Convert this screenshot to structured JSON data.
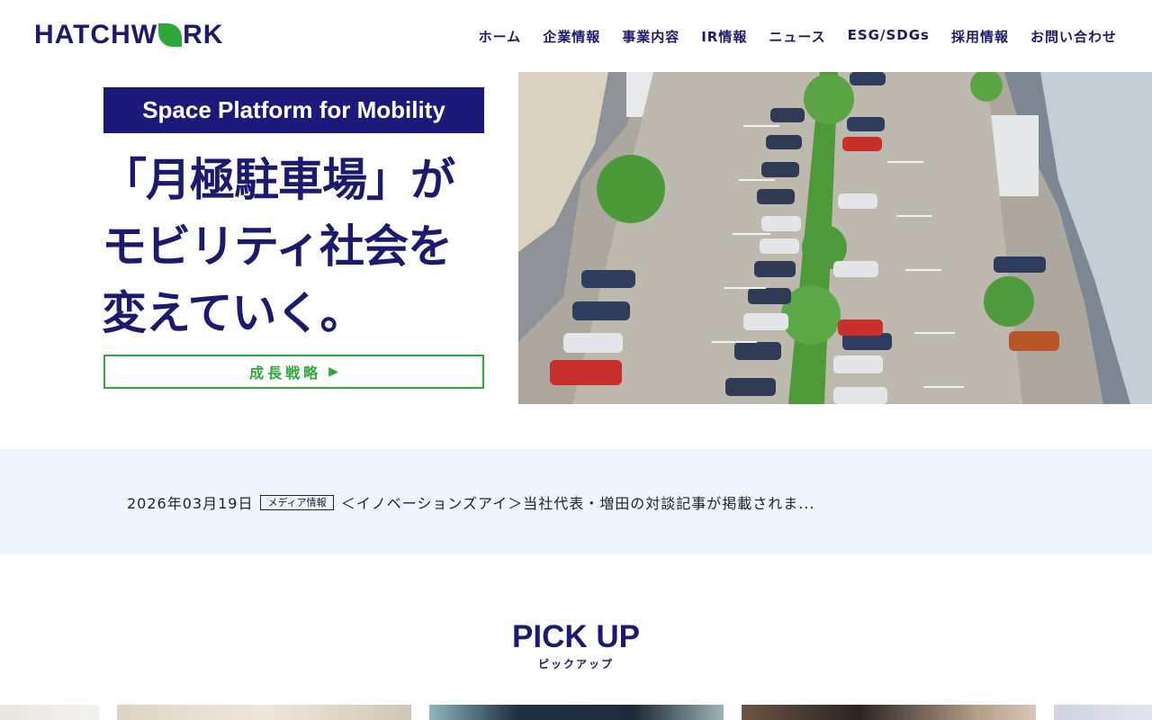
{
  "header": {
    "logo_text_left": "HATCHW",
    "logo_text_right": "RK",
    "nav": [
      {
        "label": "ホーム"
      },
      {
        "label": "企業情報"
      },
      {
        "label": "事業内容"
      },
      {
        "label": "IR情報"
      },
      {
        "label": "ニュース"
      },
      {
        "label": "ESG/SDGs"
      },
      {
        "label": "採用情報"
      },
      {
        "label": "お問い合わせ"
      }
    ]
  },
  "hero": {
    "tagline": "Space Platform for Mobility",
    "headline_lines": [
      "「月極駐車場」が",
      "モビリティ社会を",
      "変えていく。"
    ],
    "button_label": "成長戦略",
    "button_arrow": "▶"
  },
  "news": {
    "date": "2026年03月19日",
    "category": "メディア情報",
    "title": "＜イノベーションズアイ＞当社代表・増田の対談記事が掲載されま..."
  },
  "pickup": {
    "title": "PICK UP",
    "subtitle": "ピックアップ"
  },
  "colors": {
    "brand_navy": "#1b1a6e",
    "brand_green": "#2fa73a",
    "news_band": "#eef5fc"
  }
}
